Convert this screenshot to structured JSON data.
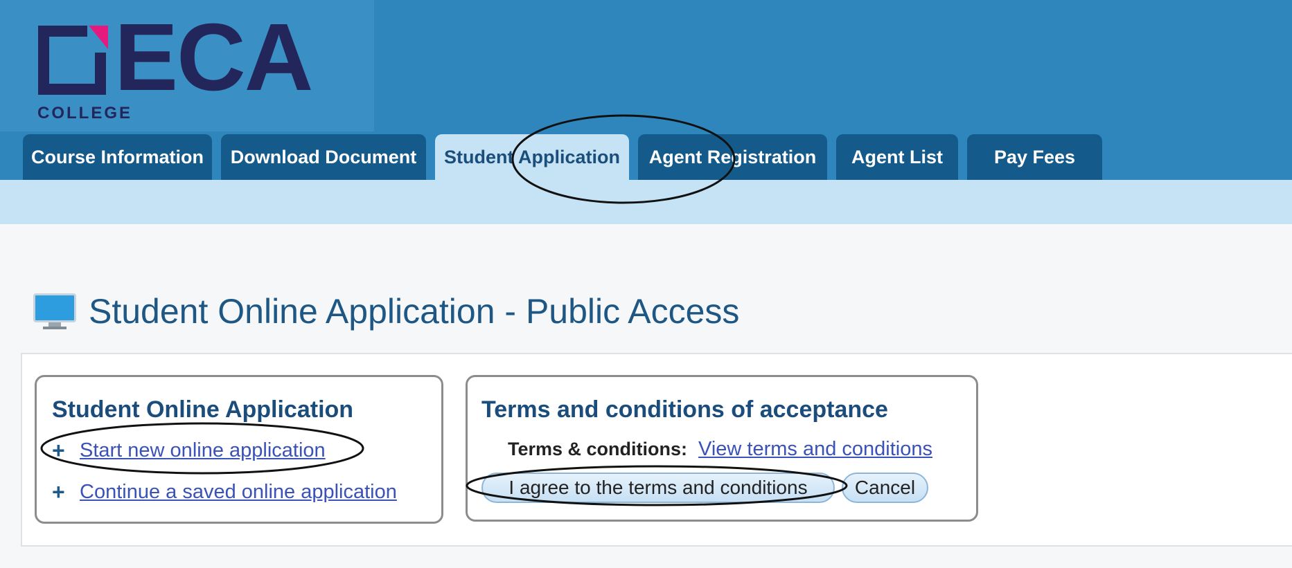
{
  "logo": {
    "main": "ECA",
    "sub": "COLLEGE"
  },
  "nav": {
    "tabs": [
      {
        "label": "Course Information"
      },
      {
        "label": "Download Document"
      },
      {
        "label": "Student Application",
        "active": true
      },
      {
        "label": "Agent Registration"
      },
      {
        "label": "Agent List"
      },
      {
        "label": "Pay Fees"
      }
    ]
  },
  "page": {
    "title": "Student Online Application - Public Access",
    "icon": "monitor-icon"
  },
  "application_box": {
    "title": "Student Online Application",
    "links": [
      {
        "label": "Start new online application"
      },
      {
        "label": "Continue a saved online application"
      }
    ]
  },
  "terms_box": {
    "title": "Terms and conditions of acceptance",
    "label": "Terms & conditions:",
    "link": "View terms and conditions",
    "agree_button": "I agree to the terms and conditions",
    "cancel_button": "Cancel"
  },
  "colors": {
    "header": "#2f86bd",
    "tab": "#145a8a",
    "subbar": "#c5e3f4",
    "brand_navy": "#23265a",
    "brand_magenta": "#e6197e"
  }
}
